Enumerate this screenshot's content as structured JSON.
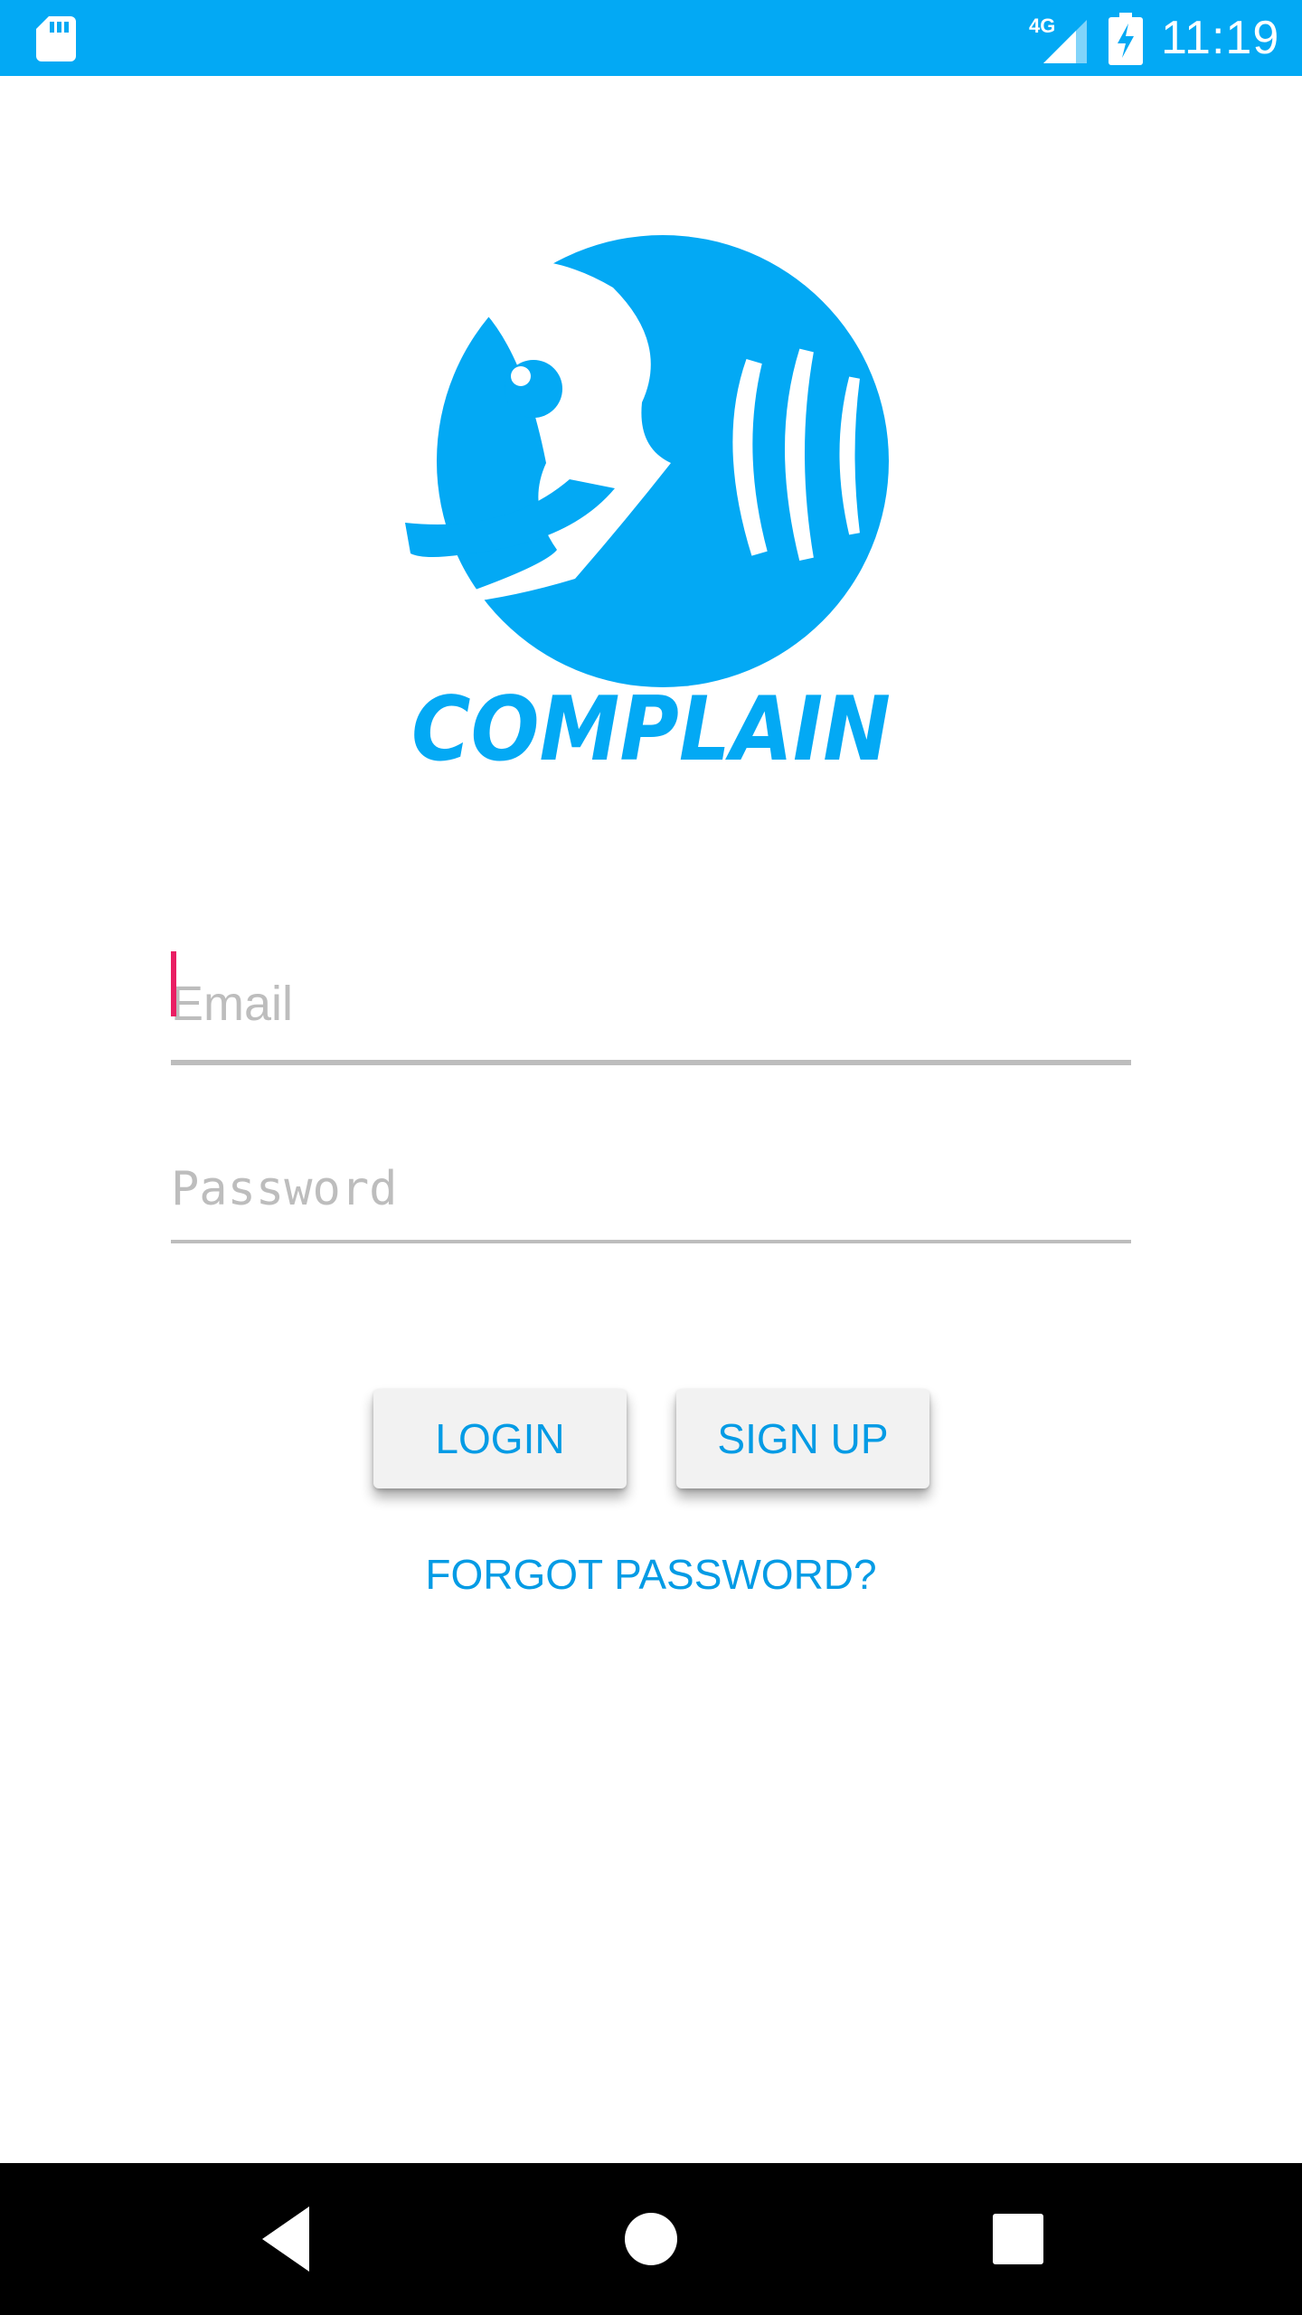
{
  "status_bar": {
    "time": "11:19",
    "network": "4G",
    "color": "#03A9F4",
    "icons": [
      "sd-card-icon",
      "signal-icon",
      "battery-charging-icon"
    ]
  },
  "logo": {
    "text": "COMPLAIN",
    "color": "#03A9F4",
    "icon": "fish-logo-icon"
  },
  "form": {
    "email_placeholder": "Email",
    "password_placeholder": "Password"
  },
  "buttons": {
    "login_label": "LOGIN",
    "signup_label": "SIGN UP",
    "forgot_label": "FORGOT PASSWORD?"
  },
  "nav_bar": {
    "icons": [
      "back-icon",
      "home-icon",
      "recents-icon"
    ]
  },
  "colors": {
    "accent": "#039BE5",
    "cursor": "#E91E63",
    "underline": "#BDBDBD"
  }
}
